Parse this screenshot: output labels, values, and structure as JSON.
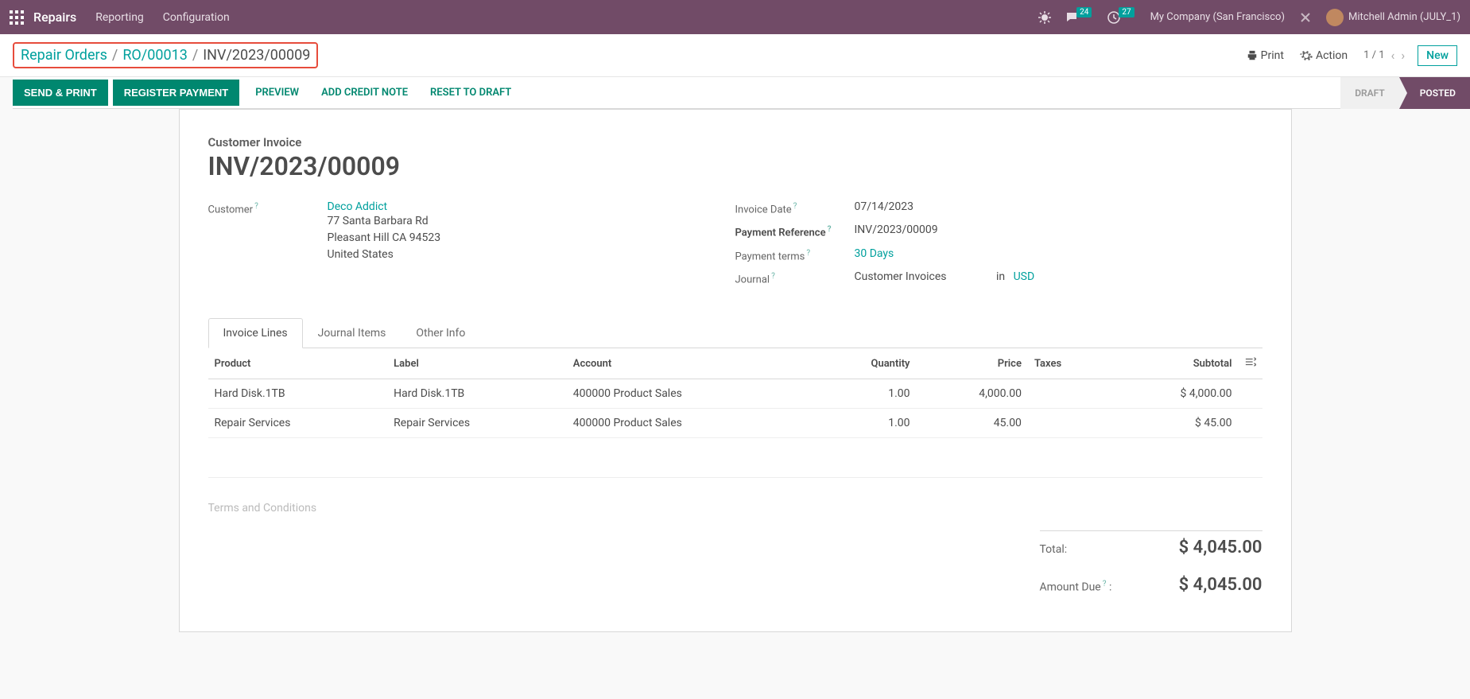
{
  "topbar": {
    "app_name": "Repairs",
    "menu": [
      "Reporting",
      "Configuration"
    ],
    "messages_badge": "24",
    "activities_badge": "27",
    "company": "My Company (San Francisco)",
    "user": "Mitchell Admin (JULY_1)"
  },
  "breadcrumb": {
    "level1": "Repair Orders",
    "level2": "RO/00013",
    "current": "INV/2023/00009"
  },
  "controlbar": {
    "print": "Print",
    "action": "Action",
    "pager": "1 / 1",
    "new_btn": "New"
  },
  "actions": {
    "send_print": "SEND & PRINT",
    "register_payment": "REGISTER PAYMENT",
    "preview": "PREVIEW",
    "add_credit_note": "ADD CREDIT NOTE",
    "reset_to_draft": "RESET TO DRAFT"
  },
  "status": {
    "draft": "DRAFT",
    "posted": "POSTED"
  },
  "doc": {
    "label": "Customer Invoice",
    "name": "INV/2023/00009",
    "customer_label": "Customer",
    "customer_name": "Deco Addict",
    "addr1": "77 Santa Barbara Rd",
    "addr2": "Pleasant Hill CA 94523",
    "addr3": "United States",
    "invoice_date_label": "Invoice Date",
    "invoice_date": "07/14/2023",
    "payment_ref_label": "Payment Reference",
    "payment_ref": "INV/2023/00009",
    "payment_terms_label": "Payment terms",
    "payment_terms": "30 Days",
    "journal_label": "Journal",
    "journal": "Customer Invoices",
    "journal_in": "in",
    "currency": "USD"
  },
  "tabs": [
    "Invoice Lines",
    "Journal Items",
    "Other Info"
  ],
  "columns": {
    "product": "Product",
    "label": "Label",
    "account": "Account",
    "quantity": "Quantity",
    "price": "Price",
    "taxes": "Taxes",
    "subtotal": "Subtotal"
  },
  "lines": [
    {
      "product": "Hard Disk.1TB",
      "label": "Hard Disk.1TB",
      "account": "400000 Product Sales",
      "qty": "1.00",
      "price": "4,000.00",
      "taxes": "",
      "subtotal": "$ 4,000.00"
    },
    {
      "product": "Repair Services",
      "label": "Repair Services",
      "account": "400000 Product Sales",
      "qty": "1.00",
      "price": "45.00",
      "taxes": "",
      "subtotal": "$ 45.00"
    }
  ],
  "terms_placeholder": "Terms and Conditions",
  "totals": {
    "total_label": "Total:",
    "total": "$ 4,045.00",
    "amount_due_label": "Amount Due",
    "amount_due": "$ 4,045.00"
  }
}
